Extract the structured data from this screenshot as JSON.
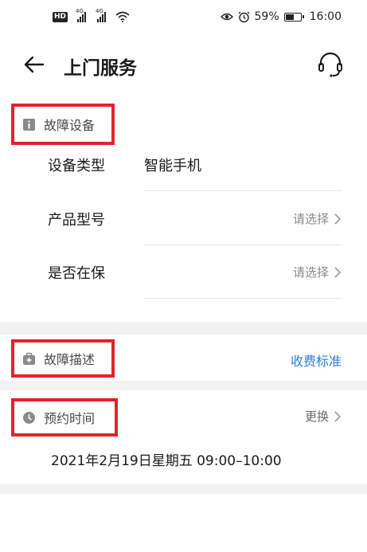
{
  "status_bar": {
    "hd": "HD",
    "network1": "4G",
    "network2": "4G",
    "battery_percent": "59%",
    "battery_level": 0.59,
    "time": "16:00"
  },
  "header": {
    "title": "上门服务",
    "back_icon": "arrow-left-icon",
    "service_icon": "headset-icon"
  },
  "fault_device": {
    "section_title": "故障设备",
    "rows": [
      {
        "label": "设备类型",
        "value": "智能手机"
      },
      {
        "label": "产品型号",
        "placeholder": "请选择"
      },
      {
        "label": "是否在保",
        "placeholder": "请选择"
      }
    ]
  },
  "fault_desc": {
    "section_title": "故障描述",
    "fee_link": "收费标准"
  },
  "appointment": {
    "section_title": "预约时间",
    "change_label": "更换",
    "datetime": "2021年2月19日星期五 09:00–10:00"
  },
  "colors": {
    "accent_link": "#2a7fe6",
    "highlight_border": "#e8212b"
  }
}
